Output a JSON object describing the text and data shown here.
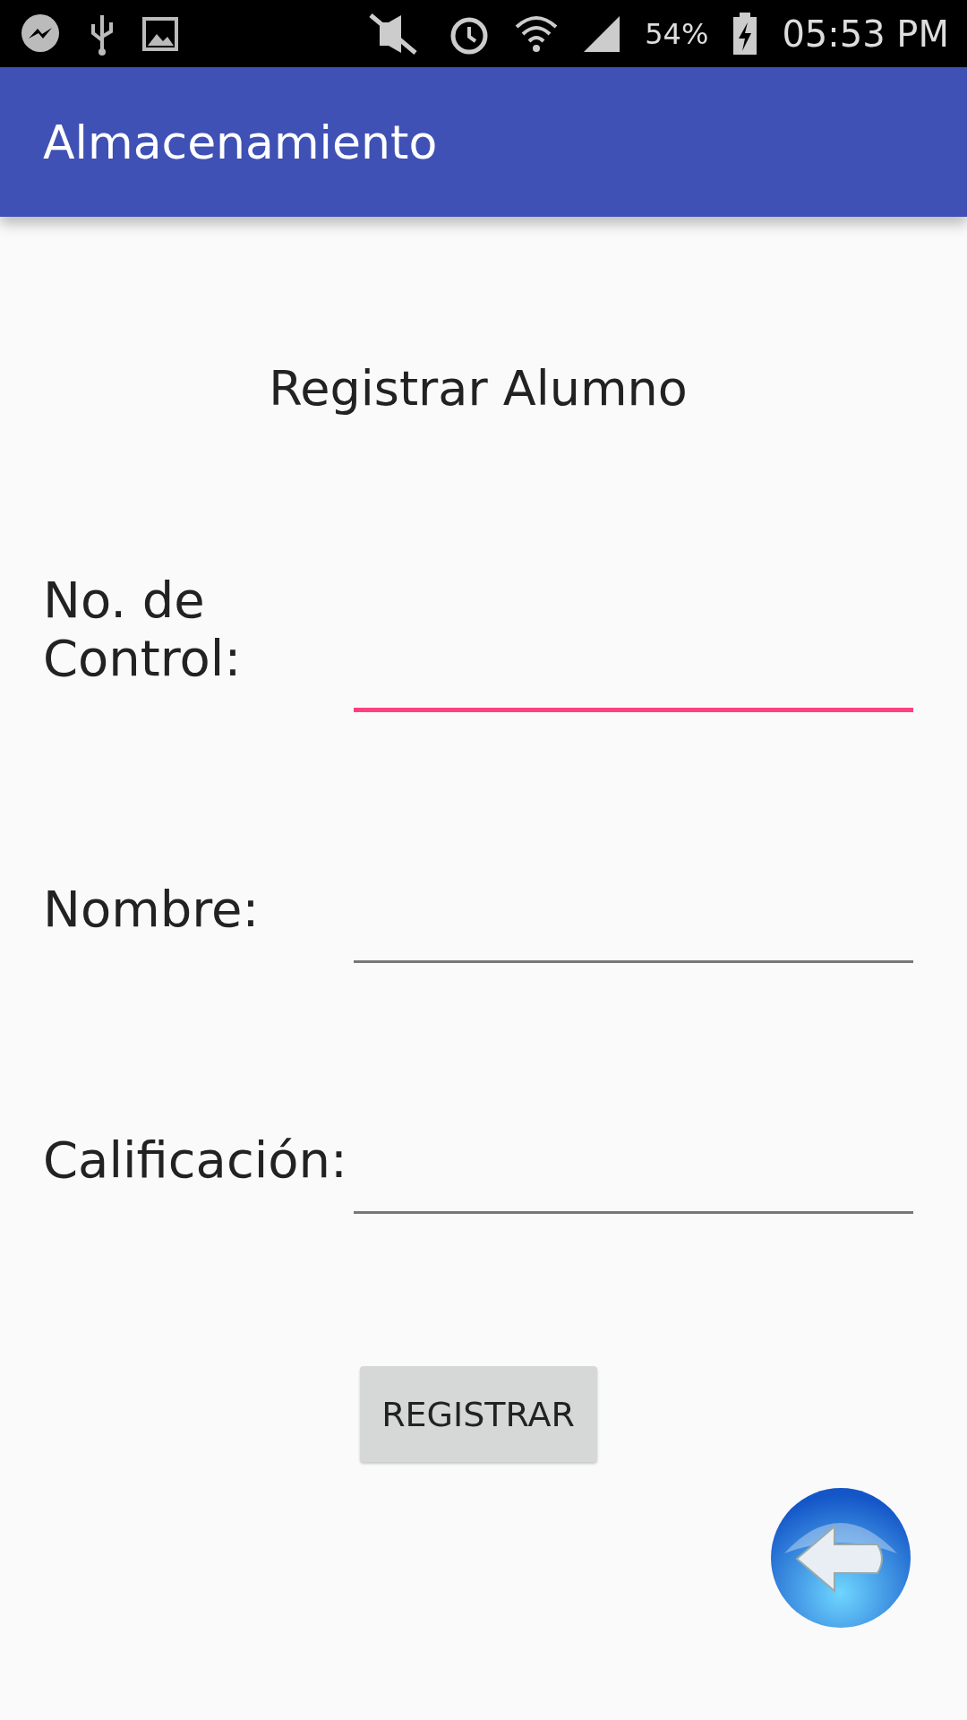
{
  "status_bar": {
    "battery": "54%",
    "time": "05:53 PM"
  },
  "app_bar": {
    "title": "Almacenamiento"
  },
  "heading": "Registrar Alumno",
  "fields": [
    {
      "label": "No. de Control:",
      "focused": true
    },
    {
      "label": "Nombre:",
      "focused": false
    },
    {
      "label": "Calificación:",
      "focused": false
    }
  ],
  "button": "REGISTRAR"
}
